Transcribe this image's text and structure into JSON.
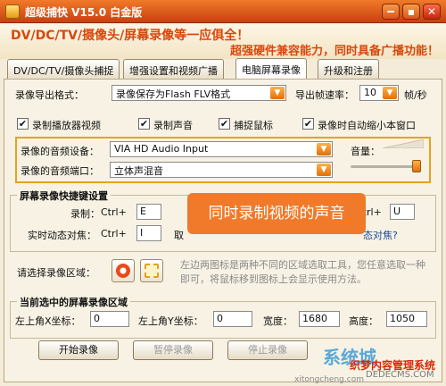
{
  "window": {
    "title": "超级捕快 V15.0 白金版"
  },
  "title_buttons": {
    "minimize": "━",
    "maximize": "▪",
    "close": "✕"
  },
  "banner": {
    "line1": "DV/DC/TV/摄像头/屏幕录像等一应俱全！",
    "line2": "超强硬件兼容能力，同时具备广播功能！"
  },
  "tabs": [
    {
      "label": "DV/DC/TV/摄像头捕捉",
      "active": false
    },
    {
      "label": "增强设置和视频广播",
      "active": false
    },
    {
      "label": "电脑屏幕录像",
      "active": true
    },
    {
      "label": "升级和注册",
      "active": false
    }
  ],
  "format": {
    "label": "录像导出格式：",
    "value": "录像保存为Flash FLV格式"
  },
  "framerate": {
    "label": "导出帧速率：",
    "value": "10",
    "unit": "帧/秒"
  },
  "checkboxes": [
    {
      "label": "录制播放器视频",
      "checked": true
    },
    {
      "label": "录制声音",
      "checked": true
    },
    {
      "label": "捕捉鼠标",
      "checked": true
    },
    {
      "label": "录像时自动缩小本窗口",
      "checked": true
    }
  ],
  "audio": {
    "device_label": "录像的音频设备：",
    "device_value": "VIA HD Audio Input",
    "port_label": "录像的音频端口：",
    "port_value": "立体声混音",
    "volume_label": "音量：",
    "volume_level": 0.95
  },
  "hotkeys": {
    "title": "屏幕录像快捷键设置",
    "record_label": "录制：",
    "record_mod": "Ctrl+",
    "record_key": "E",
    "track_label": "实时动态对焦：",
    "track_mod": "Ctrl+",
    "track_key": "I",
    "cut_text": "取",
    "right_mod": "Ctrl+",
    "right_key": "U",
    "right_link": "态对焦?"
  },
  "tooltip": "同时录制视频的声音",
  "region": {
    "label": "请选择录像区域：",
    "help": "左边两图标是两种不同的区域选取工具，您任意选取一种即可，将鼠标移到图标上会显示使用方法。"
  },
  "current_region": {
    "title": "当前选中的屏幕录像区域",
    "x_label": "左上角X坐标：",
    "x_value": "0",
    "y_label": "左上角Y坐标：",
    "y_value": "0",
    "w_label": "宽度：",
    "w_value": "1680",
    "h_label": "高度：",
    "h_value": "1050"
  },
  "buttons": {
    "start": "开始录像",
    "pause": "暂停录像",
    "stop": "停止录像"
  },
  "watermark": {
    "logo": "系统城",
    "site": "织梦内容管理系统",
    "url": "DEDECMS.COM",
    "url2": "xitongcheng.com"
  }
}
